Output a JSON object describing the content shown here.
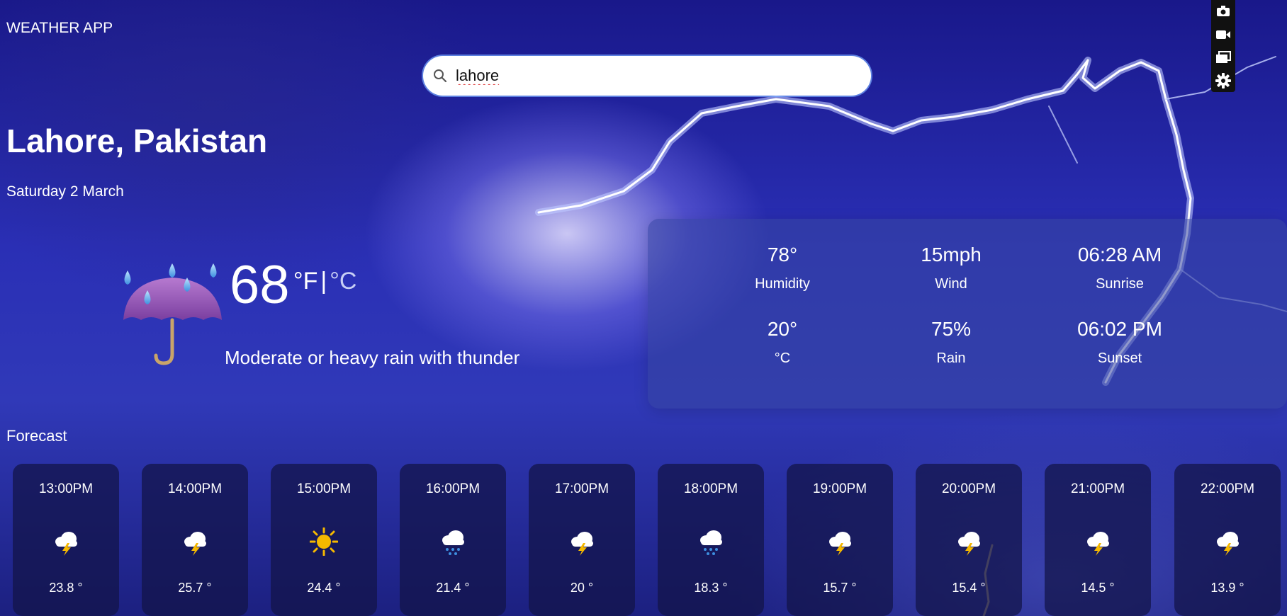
{
  "app": {
    "title": "WEATHER APP"
  },
  "search": {
    "value": "lahore"
  },
  "location": {
    "city": "Lahore, Pakistan",
    "date": "Saturday 2 March"
  },
  "current": {
    "temperature": "68",
    "unit_f": "°F",
    "unit_separator": "|",
    "unit_c": "°C",
    "condition": "Moderate or heavy rain with thunder",
    "icon": "umbrella-rain-icon"
  },
  "stats": [
    {
      "value": "78°",
      "label": "Humidity"
    },
    {
      "value": "15mph",
      "label": "Wind"
    },
    {
      "value": "06:28 AM",
      "label": "Sunrise"
    },
    {
      "value": "20°",
      "label": "°C"
    },
    {
      "value": "75%",
      "label": "Rain"
    },
    {
      "value": "06:02 PM",
      "label": "Sunset"
    }
  ],
  "forecast": {
    "label": "Forecast",
    "items": [
      {
        "time": "13:00PM",
        "icon": "thunder-cloud-icon",
        "temp": "23.8 °"
      },
      {
        "time": "14:00PM",
        "icon": "thunder-cloud-icon",
        "temp": "25.7 °"
      },
      {
        "time": "15:00PM",
        "icon": "sun-icon",
        "temp": "24.4 °"
      },
      {
        "time": "16:00PM",
        "icon": "rain-cloud-icon",
        "temp": "21.4 °"
      },
      {
        "time": "17:00PM",
        "icon": "thunder-cloud-icon",
        "temp": "20 °"
      },
      {
        "time": "18:00PM",
        "icon": "rain-cloud-icon",
        "temp": "18.3 °"
      },
      {
        "time": "19:00PM",
        "icon": "thunder-cloud-icon",
        "temp": "15.7 °"
      },
      {
        "time": "20:00PM",
        "icon": "thunder-cloud-icon",
        "temp": "15.4 °"
      },
      {
        "time": "21:00PM",
        "icon": "thunder-cloud-icon",
        "temp": "14.5 °"
      },
      {
        "time": "22:00PM",
        "icon": "thunder-cloud-icon",
        "temp": "13.9 °"
      }
    ]
  },
  "toolbar": {
    "icons": [
      "camera-icon",
      "video-icon",
      "window-icon",
      "gear-icon"
    ]
  },
  "colors": {
    "card_bg": "#12144a",
    "stats_bg": "#3746a0",
    "sky": "#2a2fb5",
    "sun": "#f5b800"
  }
}
